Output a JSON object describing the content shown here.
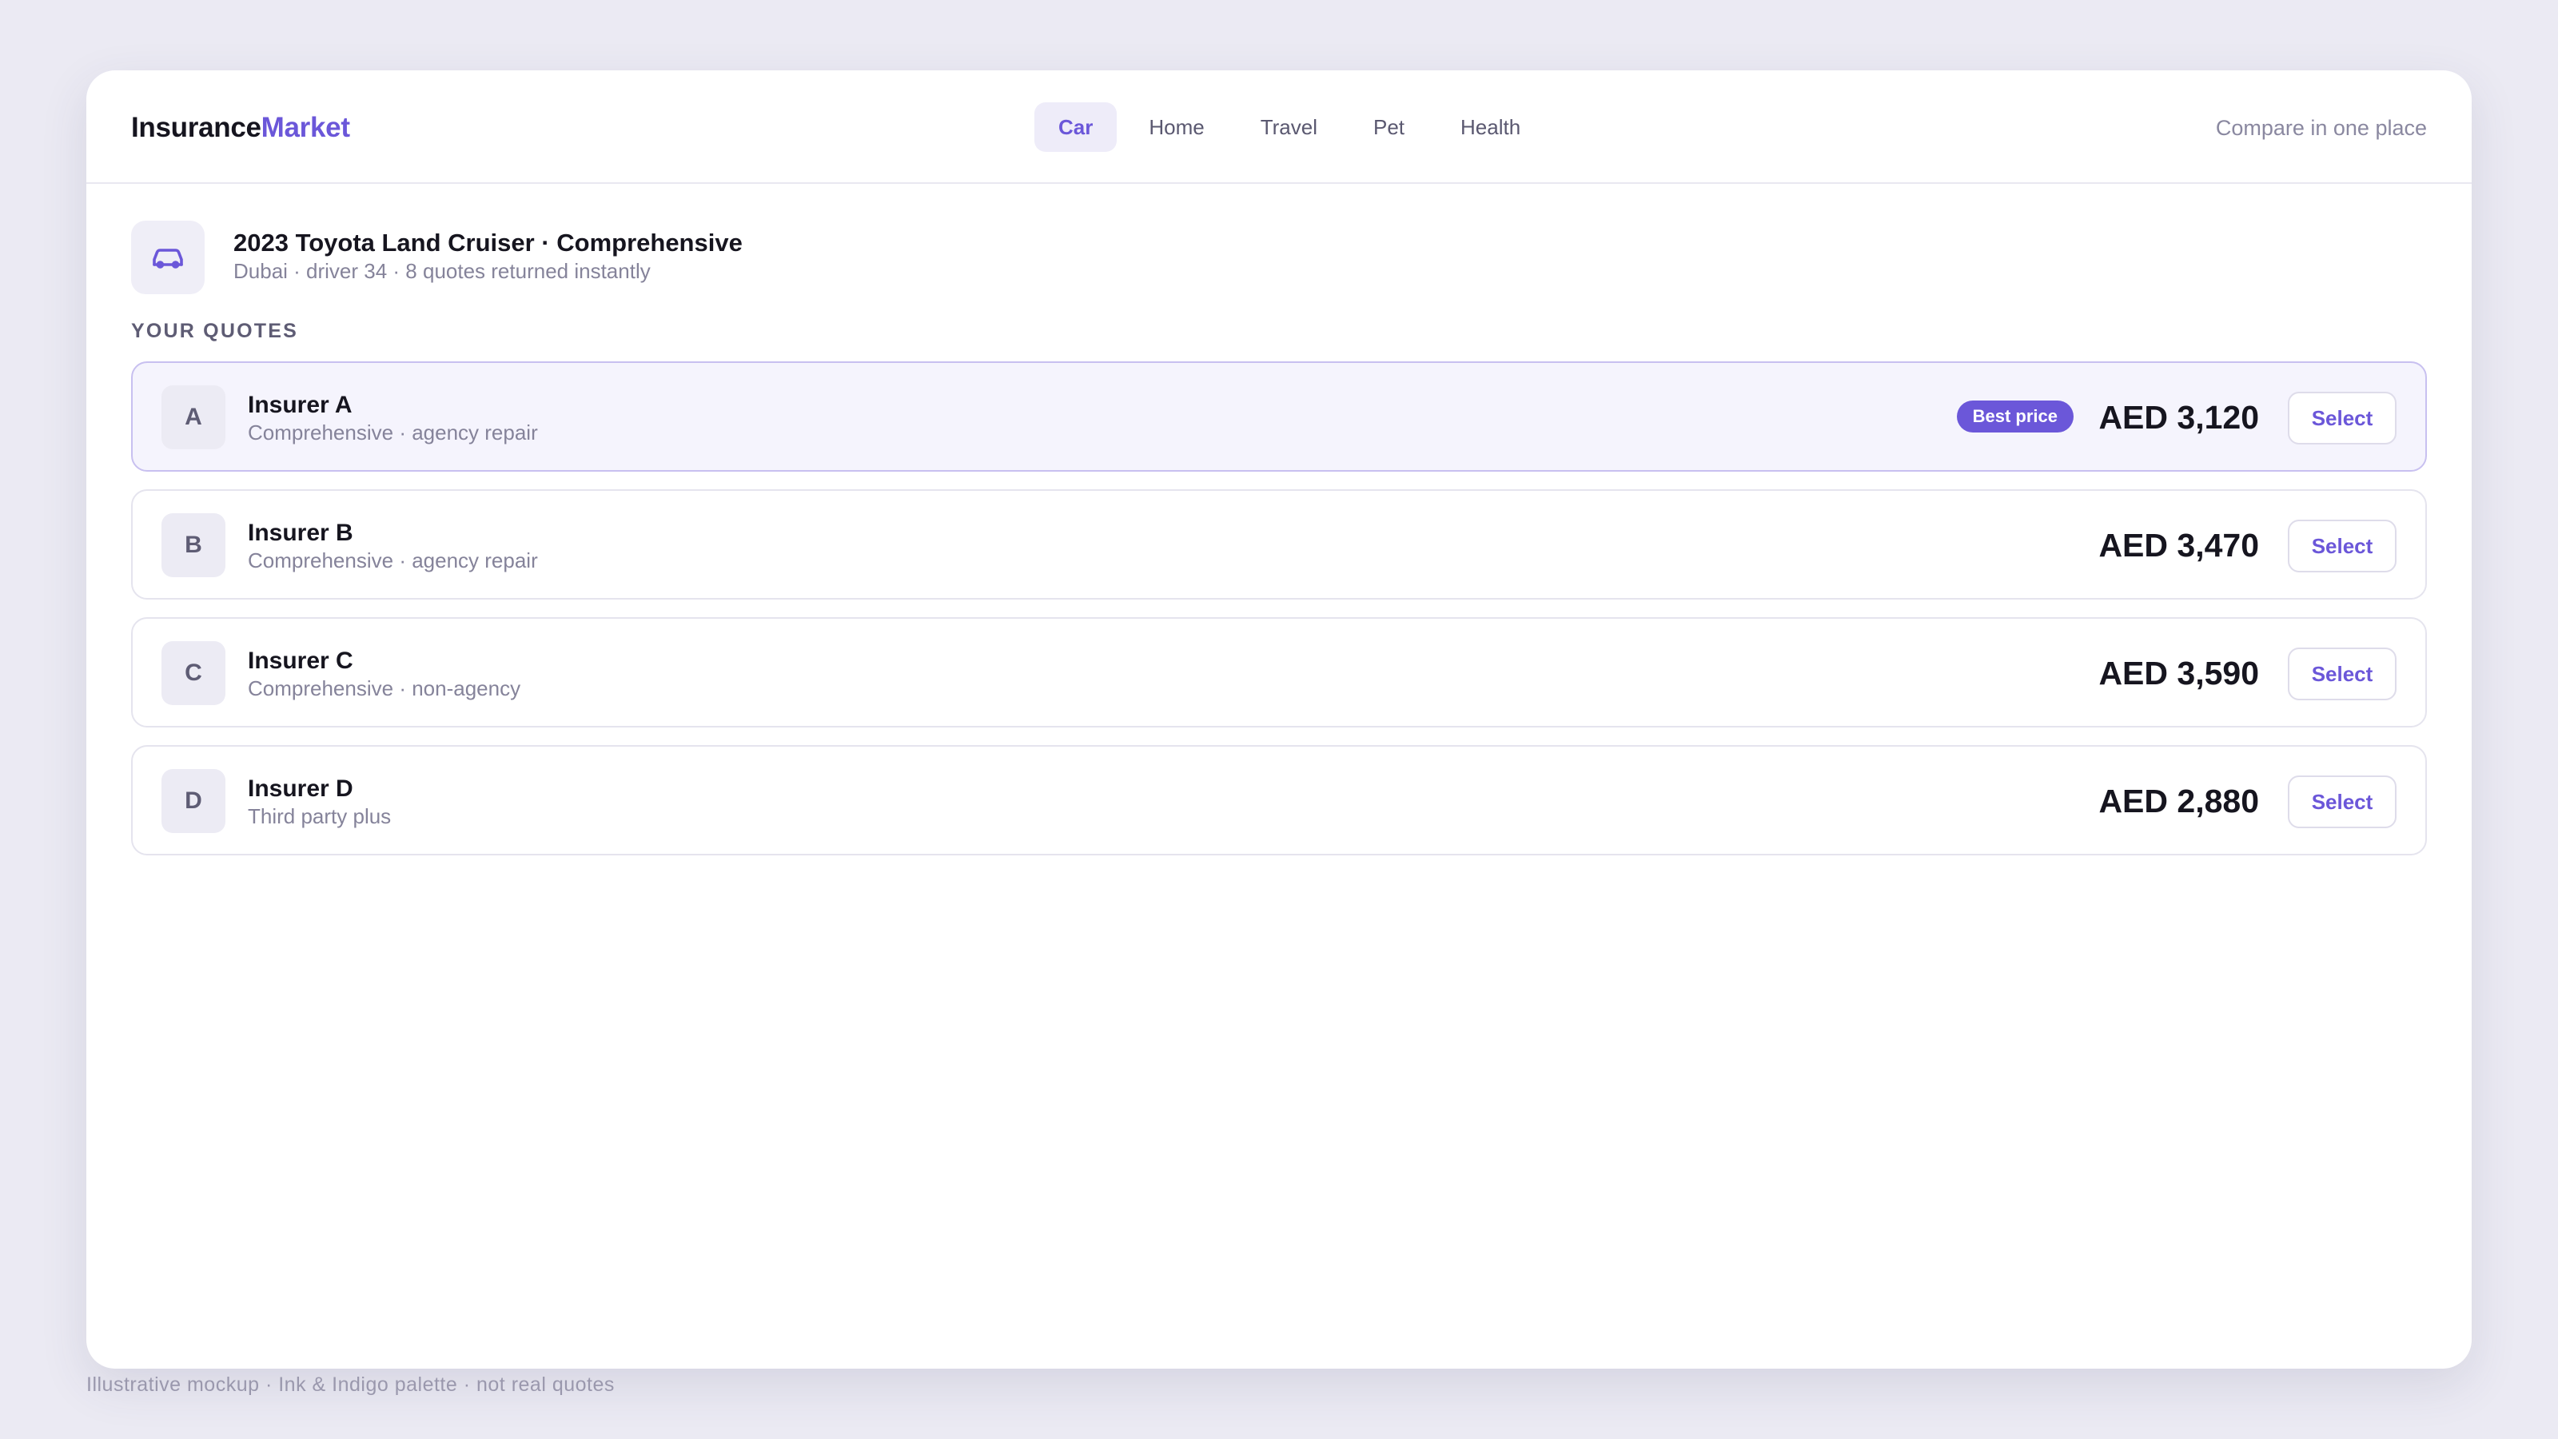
{
  "brand": {
    "part1": "Insurance",
    "part2": "Market"
  },
  "nav": {
    "tabs": [
      {
        "label": "Car",
        "active": true
      },
      {
        "label": "Home",
        "active": false
      },
      {
        "label": "Travel",
        "active": false
      },
      {
        "label": "Pet",
        "active": false
      },
      {
        "label": "Health",
        "active": false
      }
    ]
  },
  "header": {
    "tagline": "Compare in one place"
  },
  "vehicle": {
    "icon": "car-icon",
    "title": "2023 Toyota Land Cruiser · Comprehensive",
    "subtitle": "Dubai · driver 34 · 8 quotes returned instantly"
  },
  "quotes_section": {
    "label": "YOUR QUOTES"
  },
  "quotes": [
    {
      "initial": "A",
      "name": "Insurer A",
      "description": "Comprehensive · agency repair",
      "badge": "Best price",
      "price": "AED 3,120",
      "select_label": "Select",
      "highlighted": true
    },
    {
      "initial": "B",
      "name": "Insurer B",
      "description": "Comprehensive · agency repair",
      "badge": "",
      "price": "AED 3,470",
      "select_label": "Select",
      "highlighted": false
    },
    {
      "initial": "C",
      "name": "Insurer C",
      "description": "Comprehensive · non-agency",
      "badge": "",
      "price": "AED 3,590",
      "select_label": "Select",
      "highlighted": false
    },
    {
      "initial": "D",
      "name": "Insurer D",
      "description": "Third party plus",
      "badge": "",
      "price": "AED 2,880",
      "select_label": "Select",
      "highlighted": false
    }
  ],
  "footnote": "Illustrative mockup · Ink & Indigo palette · not real quotes",
  "colors": {
    "accent": "#6b57d9",
    "ink": "#16151f",
    "muted": "#85839a",
    "background": "#ebeaf3"
  }
}
